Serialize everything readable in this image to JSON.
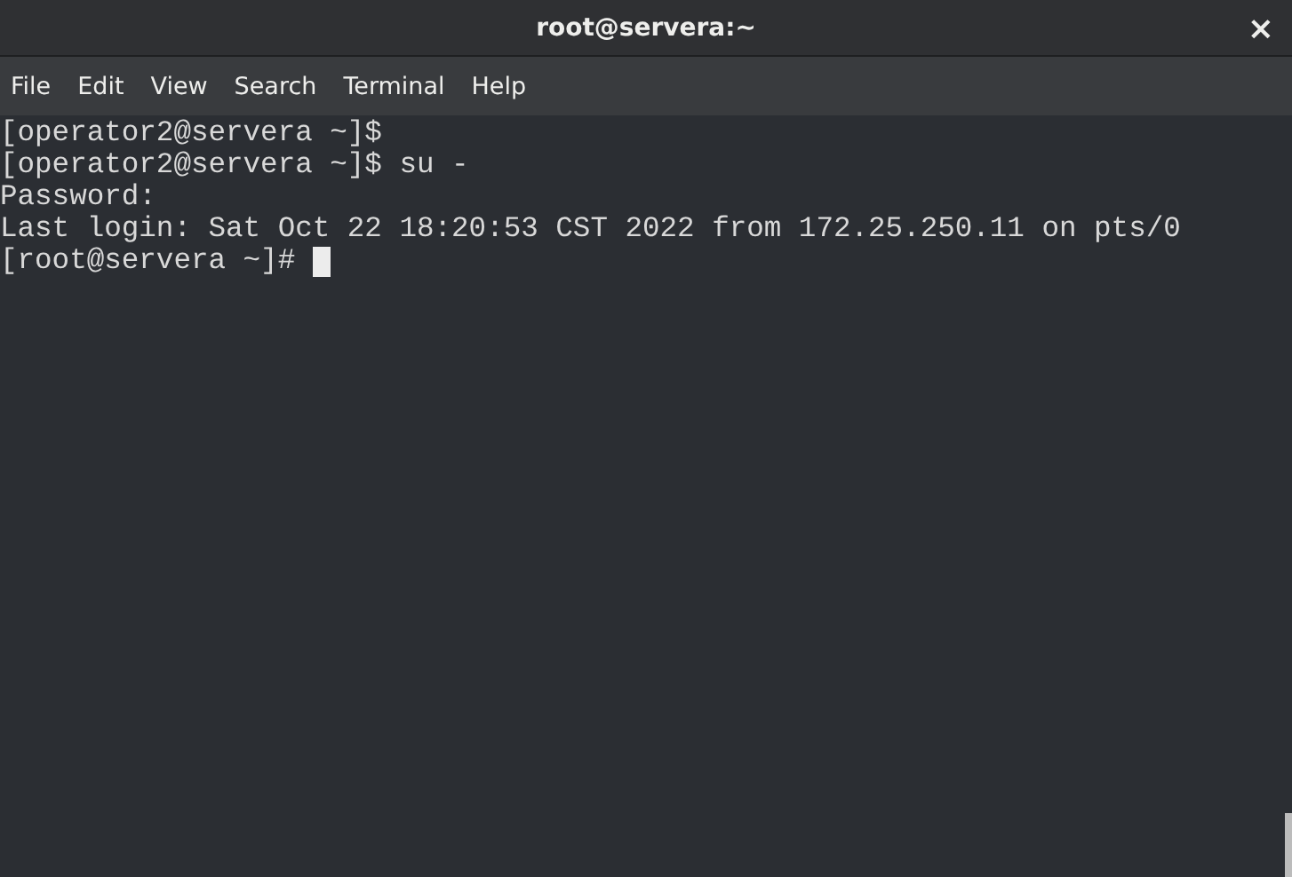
{
  "window": {
    "title": "root@servera:~",
    "close": "×"
  },
  "menu": [
    {
      "label": "File"
    },
    {
      "label": "Edit"
    },
    {
      "label": "View"
    },
    {
      "label": "Search"
    },
    {
      "label": "Terminal"
    },
    {
      "label": "Help"
    }
  ],
  "terminal": {
    "lines": [
      {
        "text": "[operator2@servera ~]$"
      },
      {
        "text": "[operator2@servera ~]$ su -"
      },
      {
        "text": "Password:"
      },
      {
        "text": "Last login: Sat Oct 22 18:20:53 CST 2022 from 172.25.250.11 on pts/0"
      },
      {
        "text": "[root@servera ~]#",
        "cursor": true
      }
    ]
  }
}
